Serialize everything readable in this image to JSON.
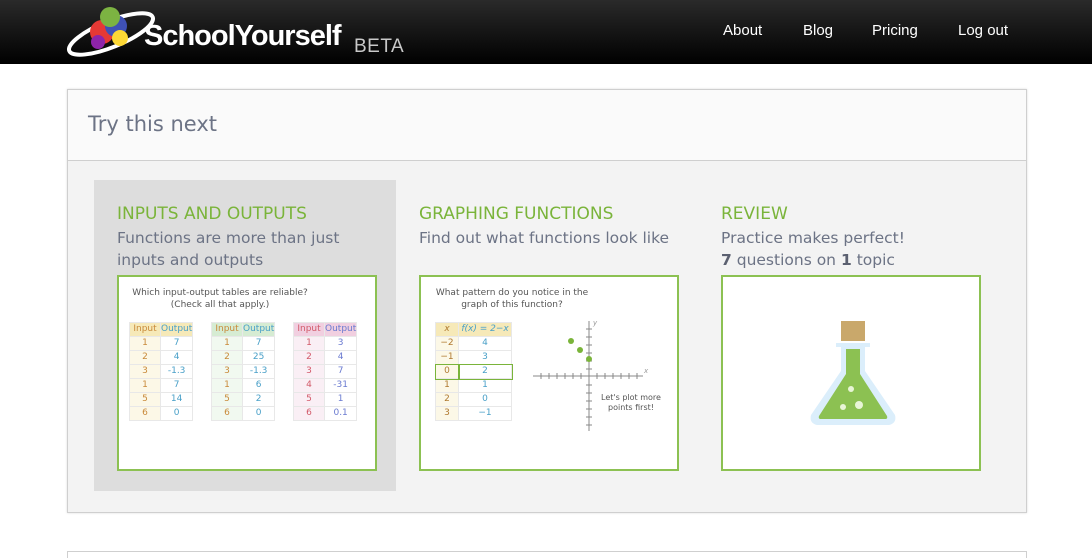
{
  "brand": {
    "name": "SchoolYourself",
    "badge": "BETA",
    "colors": {
      "header_bg": "#000000",
      "accent_green": "#7ab43a",
      "frame_green": "#8cc152"
    }
  },
  "nav": [
    {
      "label": "About"
    },
    {
      "label": "Blog"
    },
    {
      "label": "Pricing"
    },
    {
      "label": "Log out"
    }
  ],
  "panel": {
    "title": "Try this next",
    "cards": [
      {
        "title": "INPUTS AND OUTPUTS",
        "desc_line1": "Functions are more than just",
        "desc_line2": "inputs and outputs",
        "thumb": {
          "question_line1": "Which input-output tables are reliable?",
          "question_line2": "(Check all that apply.)",
          "tables": [
            {
              "head": [
                "Input",
                "Output"
              ],
              "rows": [
                [
                  "1",
                  "7"
                ],
                [
                  "2",
                  "4"
                ],
                [
                  "3",
                  "-1.3"
                ],
                [
                  "1",
                  "7"
                ],
                [
                  "5",
                  "14"
                ],
                [
                  "6",
                  "0"
                ]
              ],
              "color": "#f6e9b8"
            },
            {
              "head": [
                "Input",
                "Output"
              ],
              "rows": [
                [
                  "1",
                  "7"
                ],
                [
                  "2",
                  "25"
                ],
                [
                  "3",
                  "-1.3"
                ],
                [
                  "1",
                  "6"
                ],
                [
                  "5",
                  "2"
                ],
                [
                  "6",
                  "0"
                ]
              ],
              "color": "#d6ecd3"
            },
            {
              "head": [
                "Input",
                "Output"
              ],
              "rows": [
                [
                  "1",
                  "3"
                ],
                [
                  "2",
                  "4"
                ],
                [
                  "3",
                  "7"
                ],
                [
                  "4",
                  "-31"
                ],
                [
                  "5",
                  "1"
                ],
                [
                  "6",
                  "0.1"
                ]
              ],
              "color": "#f1cfe0"
            }
          ]
        }
      },
      {
        "title": "GRAPHING FUNCTIONS",
        "desc_line1": "Find out what functions look like",
        "thumb": {
          "question_line1": "What pattern do you notice in the",
          "question_line2": "graph of this function?",
          "head": [
            "x",
            "f(x) = 2−x"
          ],
          "rows": [
            [
              "−2",
              "4"
            ],
            [
              "−1",
              "3"
            ],
            [
              "0",
              "2"
            ],
            [
              "1",
              "1"
            ],
            [
              "2",
              "0"
            ],
            [
              "3",
              "−1"
            ]
          ],
          "hint_line1": "Let's plot more",
          "hint_line2": "points first!",
          "axis_x": "x",
          "axis_y": "y"
        }
      },
      {
        "title": "REVIEW",
        "desc_line1": "Practice makes perfect!",
        "count_questions": "7",
        "questions_text": "questions on",
        "count_topics": "1",
        "topics_text": "topic",
        "thumb": {
          "icon": "flask-icon"
        }
      }
    ]
  }
}
